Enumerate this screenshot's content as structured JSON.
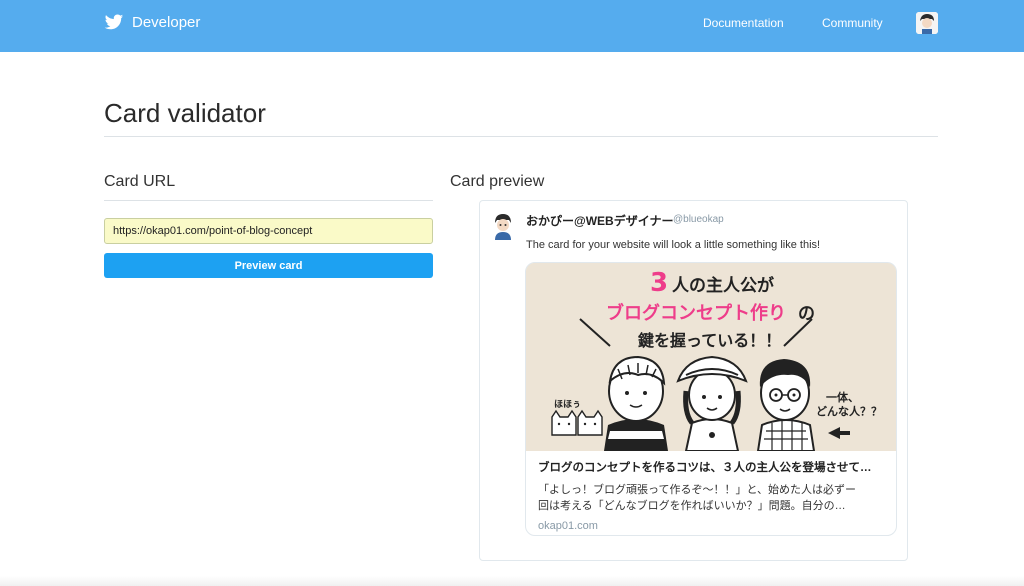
{
  "header": {
    "brand": "Developer",
    "nav": [
      "Documentation",
      "Community"
    ]
  },
  "page": {
    "title": "Card validator"
  },
  "form": {
    "section_title": "Card URL",
    "url_value": "https://okap01.com/point-of-blog-concept",
    "button_label": "Preview card"
  },
  "preview": {
    "section_title": "Card preview",
    "tweet": {
      "name": "おかぴー@WEBデザイナー",
      "handle": "@blueokap",
      "text": "The card for your website will look a little something like this!"
    },
    "card": {
      "image_text": {
        "line1_num": "3",
        "line1_rest": "人の主人公が",
        "line2_pink": "ブログコンセプト作り",
        "line2_rest": "の",
        "line3": "鍵を握っている！！",
        "left_note": "ほほぅ",
        "right_note_1": "一体、",
        "right_note_2": "どんな人？？"
      },
      "title": "ブログのコンセプトを作るコツは、３人の主人公を登場させて…",
      "description_1": "「よしっ！ブログ頑張って作るぞ〜！！」と、始めた人は必ずー",
      "description_2": "回は考える「どんなブログを作ればいいか？」問題。自分の…",
      "domain": "okap01.com"
    }
  },
  "colors": {
    "header_bg": "#55acee",
    "button_bg": "#1da1f2",
    "input_bg": "#fafac8",
    "accent_pink": "#ee3d8a",
    "card_image_bg": "#ede4d6"
  }
}
